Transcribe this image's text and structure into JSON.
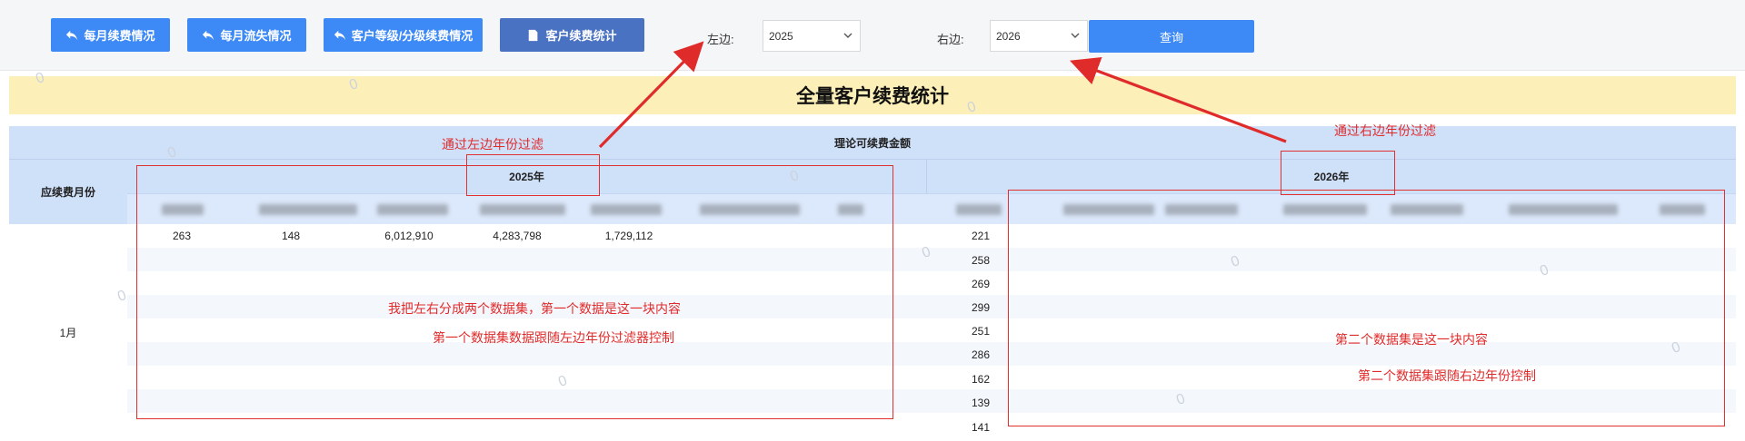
{
  "toolbar": {
    "btn_monthly_renewal": "每月续费情况",
    "btn_monthly_churn": "每月流失情况",
    "btn_customer_level": "客户等级/分级续费情况",
    "btn_customer_stats": "客户续费统计",
    "left_label": "左边:",
    "left_year": "2025",
    "right_label": "右边:",
    "right_year": "2026",
    "query_label": "查询"
  },
  "report": {
    "title": "全量客户续费统计",
    "group_header": "理论可续费金额",
    "row_header": "应续费月份",
    "left_year_header": "2025年",
    "right_year_header": "2026年",
    "month_label": "1月",
    "left_first_row": [
      "263",
      "148",
      "6,012,910",
      "4,283,798",
      "1,729,112"
    ],
    "right_first_col": [
      "221",
      "258",
      "269",
      "299",
      "251",
      "286",
      "162",
      "139",
      "141"
    ]
  },
  "annotations": {
    "left_filter": "通过左边年份过滤",
    "right_filter": "通过右边年份过滤",
    "left_dataset_1": "我把左右分成两个数据集，第一个数据是这一块内容",
    "left_dataset_2": "第一个数据集数据跟随左边年份过滤器控制",
    "right_dataset_1": "第二个数据集是这一块内容",
    "right_dataset_2": "第二个数据集跟随右边年份控制"
  },
  "watermark": "0",
  "colors": {
    "button_blue": "#3d8af7",
    "button_active": "#4a72c2",
    "header_blue": "#cfe0f9",
    "title_yellow": "#fdefb8",
    "annotation_red": "#e02b2b"
  }
}
